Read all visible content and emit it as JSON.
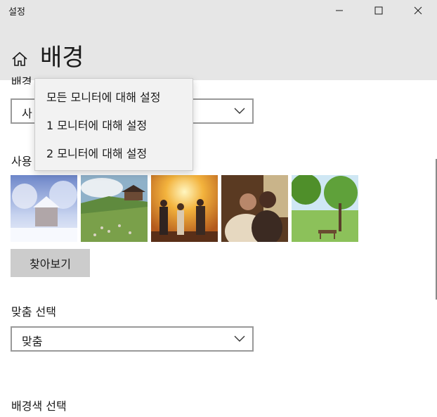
{
  "window": {
    "title": "설정"
  },
  "header": {
    "page_title": "배경"
  },
  "background_section": {
    "label_partial": "배경",
    "dropdown_value": "사"
  },
  "recent_section": {
    "label_partial": "사용"
  },
  "thumbnails": [
    "winter-village-photo",
    "alpine-meadow-photo",
    "sunset-desert-people-photo",
    "couple-portrait-photo",
    "green-park-bench-photo"
  ],
  "browse_button": "찾아보기",
  "fit_section": {
    "label": "맞춤 선택",
    "dropdown_value": "맞춤"
  },
  "color_section": {
    "label": "배경색 선택"
  },
  "monitor_menu": {
    "items": [
      "모든 모니터에 대해 설정",
      "1 모니터에 대해 설정",
      "2 모니터에 대해 설정"
    ]
  },
  "colors": {
    "chrome": "#e6e6e6",
    "control_border": "#999999",
    "button": "#cccccc",
    "flyout": "#f2f2f2"
  }
}
